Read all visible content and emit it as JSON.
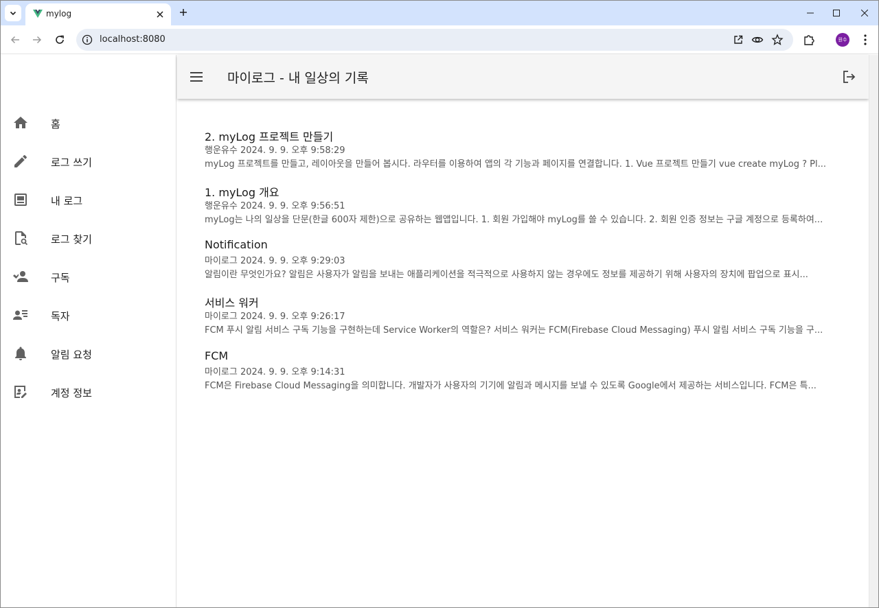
{
  "browser": {
    "tab_title": "mylog",
    "url": "localhost:8080",
    "avatar_text": "원수",
    "accent": "#d3e3fd"
  },
  "appbar": {
    "title": "마이로그 - 내 일상의 기록"
  },
  "sidebar": {
    "items": [
      {
        "label": "홈",
        "icon": "home-icon"
      },
      {
        "label": "로그 쓰기",
        "icon": "pencil-icon"
      },
      {
        "label": "내 로그",
        "icon": "document-icon"
      },
      {
        "label": "로그 찾기",
        "icon": "find-document-icon"
      },
      {
        "label": "구독",
        "icon": "people-icon"
      },
      {
        "label": "독자",
        "icon": "reader-list-icon"
      },
      {
        "label": "알림 요청",
        "icon": "bell-icon"
      },
      {
        "label": "계정 정보",
        "icon": "edit-account-icon"
      }
    ]
  },
  "posts": [
    {
      "title": "2. myLog 프로젝트 만들기",
      "meta": "행운유수 2024. 9. 9. 오후 9:58:29",
      "excerpt": "myLog 프로젝트를 만들고, 레이아웃을 만들어 봅시다. 라우터를 이용하여 앱의 각 기능과 페이지를 연결합니다. 1. Vue 프로젝트 만들기 vue create myLog ? Pl..."
    },
    {
      "title": "1. myLog 개요",
      "meta": "행운유수 2024. 9. 9. 오후 9:56:51",
      "excerpt": "myLog는 나의 일상을 단문(한글 600자 제한)으로 공유하는 웹앱입니다. 1. 회원 가입해야 myLog를 쓸 수 있습니다. 2. 회원 인증 정보는 구글 계정으로 등록하여..."
    },
    {
      "title": "Notification",
      "meta": "마이로그 2024. 9. 9. 오후 9:29:03",
      "excerpt": "알림이란 무엇인가요? 알림은 사용자가 알림을 보내는 애플리케이션을 적극적으로 사용하지 않는 경우에도 정보를 제공하기 위해 사용자의 장치에 팝업으로 표시..."
    },
    {
      "title": "서비스 워커",
      "meta": "마이로그 2024. 9. 9. 오후 9:26:17",
      "excerpt": "FCM 푸시 알림 서비스 구독 기능을 구현하는데 Service Worker의 역할은? 서비스 워커는 FCM(Firebase Cloud Messaging) 푸시 알림 서비스 구독 기능을 구..."
    },
    {
      "title": "FCM",
      "meta": "마이로그 2024. 9. 9. 오후 9:14:31",
      "excerpt": "FCM은 Firebase Cloud Messaging을 의미합니다. 개발자가 사용자의 기기에 알림과 메시지를 보낼 수 있도록 Google에서 제공하는 서비스입니다. FCM은 특..."
    }
  ]
}
